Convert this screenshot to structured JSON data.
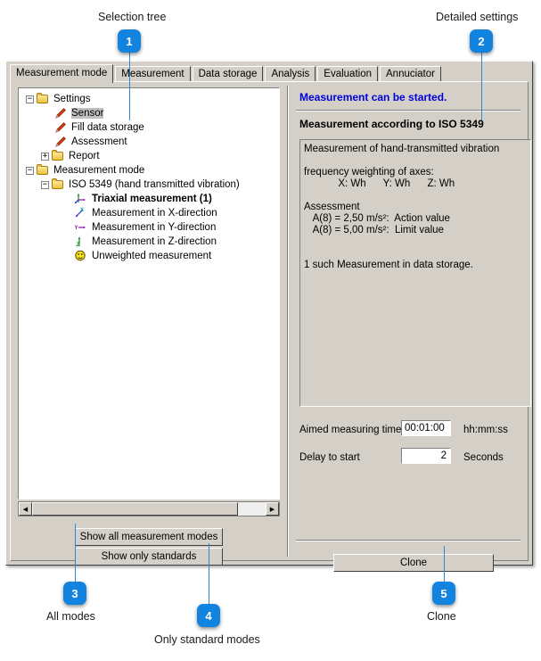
{
  "annotations": [
    {
      "id": "1",
      "label": "Selection tree",
      "number": "1"
    },
    {
      "id": "2",
      "label": "Detailed settings",
      "number": "2"
    },
    {
      "id": "3",
      "label": "All modes",
      "number": "3"
    },
    {
      "id": "4",
      "label": "Only standard modes",
      "number": "4"
    },
    {
      "id": "5",
      "label": "Clone",
      "number": "5"
    }
  ],
  "accent_color": "#1383e0",
  "tabs": [
    {
      "label": "Measurement mode",
      "active": true
    },
    {
      "label": "Measurement",
      "active": false
    },
    {
      "label": "Data storage",
      "active": false
    },
    {
      "label": "Analysis",
      "active": false
    },
    {
      "label": "Evaluation",
      "active": false
    },
    {
      "label": "Annuciator",
      "active": false
    }
  ],
  "tree": [
    {
      "label": "Settings",
      "icon": "folder-open-icon",
      "expander": "-",
      "indent": 0,
      "selected": false,
      "bold": false
    },
    {
      "label": "Sensor",
      "icon": "pencil-icon",
      "expander": "",
      "indent": 1,
      "selected": true,
      "bold": false
    },
    {
      "label": "Fill data storage",
      "icon": "pencil-icon",
      "expander": "",
      "indent": 1,
      "selected": false,
      "bold": false
    },
    {
      "label": "Assessment",
      "icon": "pencil-icon",
      "expander": "",
      "indent": 1,
      "selected": false,
      "bold": false
    },
    {
      "label": "Report",
      "icon": "folder-closed-icon",
      "expander": "+",
      "indent": 1,
      "selected": false,
      "bold": false
    },
    {
      "label": "Measurement mode",
      "icon": "folder-open-icon",
      "expander": "-",
      "indent": 0,
      "selected": false,
      "bold": false
    },
    {
      "label": "ISO 5349 (hand transmitted vibration)",
      "icon": "folder-open-icon",
      "expander": "-",
      "indent": 1,
      "selected": false,
      "bold": false
    },
    {
      "label": "Triaxial measurement (1)",
      "icon": "axis-triaxial-icon",
      "expander": "",
      "indent": 2,
      "selected": false,
      "bold": true
    },
    {
      "label": "Measurement in X-direction",
      "icon": "axis-x-icon",
      "expander": "",
      "indent": 2,
      "selected": false,
      "bold": false
    },
    {
      "label": "Measurement in Y-direction",
      "icon": "axis-y-icon",
      "expander": "",
      "indent": 2,
      "selected": false,
      "bold": false
    },
    {
      "label": "Measurement in Z-direction",
      "icon": "axis-z-icon",
      "expander": "",
      "indent": 2,
      "selected": false,
      "bold": false
    },
    {
      "label": "Unweighted measurement",
      "icon": "unweighted-icon",
      "expander": "",
      "indent": 2,
      "selected": false,
      "bold": false
    }
  ],
  "left_buttons": {
    "show_all": "Show all measurement modes",
    "show_standards": "Show only standards"
  },
  "right": {
    "status": "Measurement can be started.",
    "heading": "Measurement according to ISO 5349",
    "description": "Measurement of hand-transmitted vibration\n\nfrequency weighting of axes:\n            X: Wh      Y: Wh      Z: Wh\n\nAssessment\n   A(8) = 2,50 m/s²:  Action value\n   A(8) = 5,00 m/s²:  Limit value\n\n\n1 such Measurement in data storage.",
    "fields": [
      {
        "label": "Aimed measuring time",
        "value": "00:01:00",
        "unit": "hh:mm:ss",
        "align": "left"
      },
      {
        "label": "Delay to start",
        "value": "2",
        "unit": "Seconds",
        "align": "right"
      }
    ],
    "clone_button": "Clone"
  }
}
